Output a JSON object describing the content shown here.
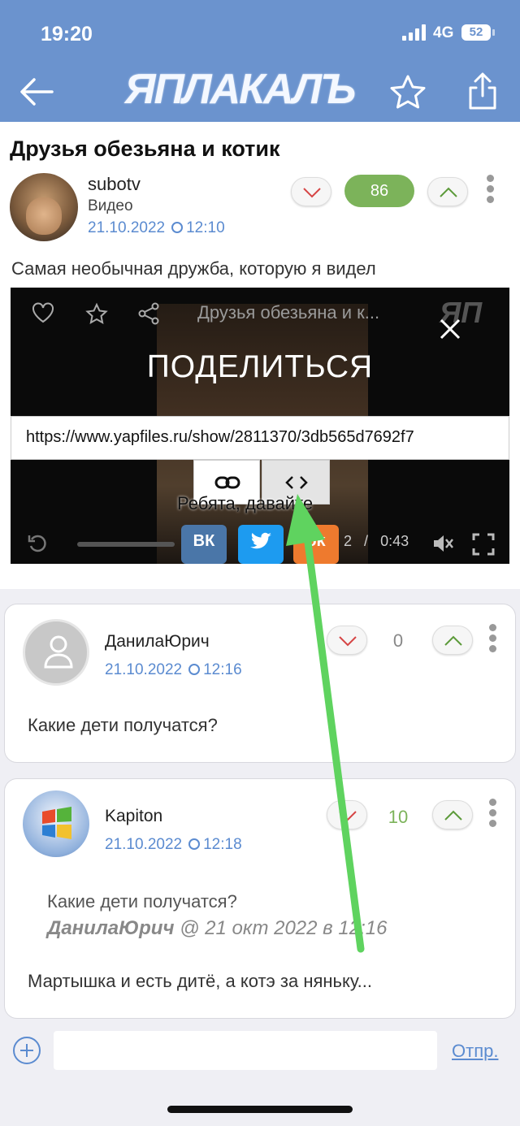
{
  "status": {
    "time": "19:20",
    "network": "4G",
    "battery": "52"
  },
  "header": {
    "logo": "ЯПЛАКАЛЪ"
  },
  "post": {
    "title": "Друзья обезьяна и котик",
    "author": "subotv",
    "category": "Видео",
    "date": "21.10.2022",
    "time": "12:10",
    "score": "86",
    "description": "Самая необычная дружба, которую я видел"
  },
  "video": {
    "title": "Друзья обезьяна и к...",
    "logo": "ЯП",
    "share_heading": "ПОДЕЛИТЬСЯ",
    "share_url": "https://www.yapfiles.ru/show/2811370/3db565d7692f7",
    "subtitle": "Ребята, давайте",
    "time_current": "2",
    "time_sep": "/",
    "time_total": "0:43",
    "social": [
      "ВК",
      "t",
      "ok"
    ]
  },
  "comments": [
    {
      "author": "ДанилаЮрич",
      "date": "21.10.2022",
      "time": "12:16",
      "score": "0",
      "text": "Какие дети получатся?"
    },
    {
      "author": "Kapiton",
      "date": "21.10.2022",
      "time": "12:18",
      "score": "10",
      "quote_text": "Какие дети получатся?",
      "quote_author": "ДанилаЮрич",
      "quote_meta": "@ 21 окт 2022 в 12:16",
      "text": "Мартышка и есть дитё, а котэ за няньку..."
    }
  ],
  "composer": {
    "send_label": "Отпр."
  },
  "colors": {
    "header": "#6b93ce",
    "accent": "#5b8bd0",
    "score_green": "#7cb35a",
    "arrow": "#5fd35f"
  }
}
